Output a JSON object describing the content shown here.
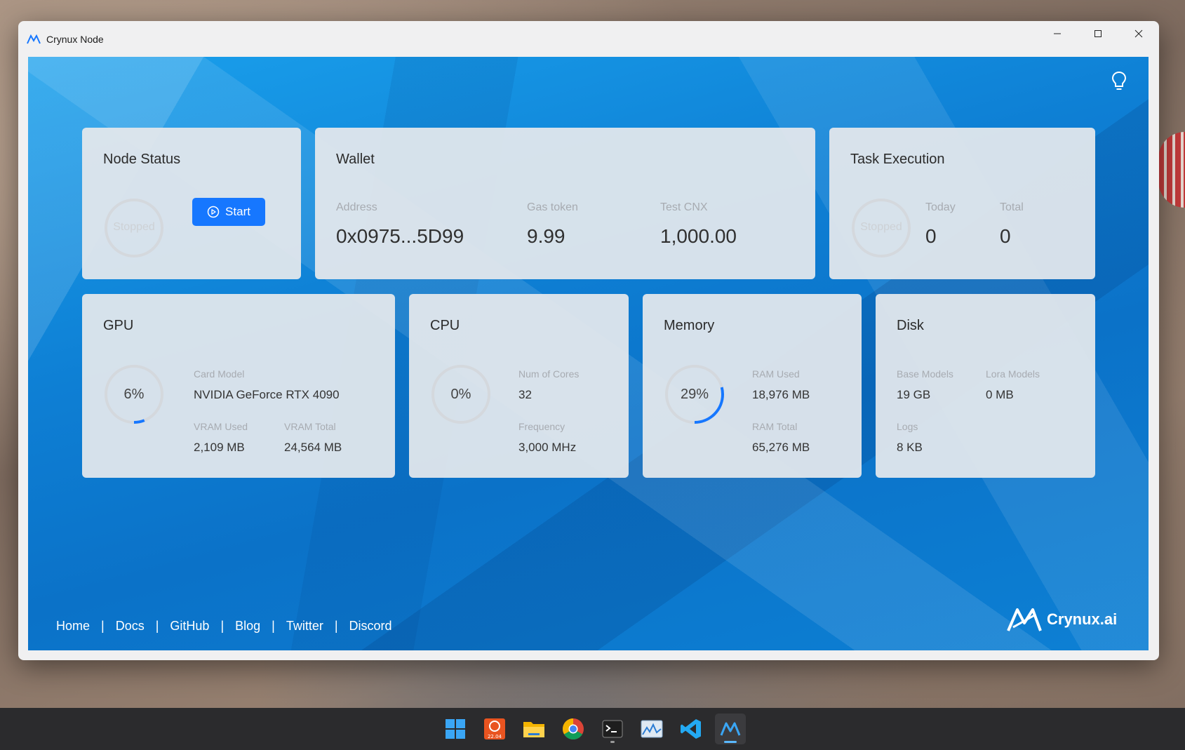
{
  "window": {
    "title": "Crynux Node"
  },
  "node_status": {
    "title": "Node Status",
    "state": "Stopped",
    "start_label": "Start"
  },
  "wallet": {
    "title": "Wallet",
    "address_label": "Address",
    "address": "0x0975...5D99",
    "gas_label": "Gas token",
    "gas_value": "9.99",
    "cnx_label": "Test CNX",
    "cnx_value": "1,000.00"
  },
  "task_execution": {
    "title": "Task Execution",
    "state": "Stopped",
    "today_label": "Today",
    "today_value": "0",
    "total_label": "Total",
    "total_value": "0"
  },
  "gpu": {
    "title": "GPU",
    "usage_text": "6%",
    "usage": 0.06,
    "card_model_label": "Card Model",
    "card_model": "NVIDIA GeForce RTX 4090",
    "vram_used_label": "VRAM Used",
    "vram_used": "2,109 MB",
    "vram_total_label": "VRAM Total",
    "vram_total": "24,564 MB"
  },
  "cpu": {
    "title": "CPU",
    "usage_text": "0%",
    "usage": 0,
    "cores_label": "Num of Cores",
    "cores": "32",
    "freq_label": "Frequency",
    "freq": "3,000 MHz"
  },
  "memory": {
    "title": "Memory",
    "usage_text": "29%",
    "usage": 0.29,
    "ram_used_label": "RAM Used",
    "ram_used": "18,976 MB",
    "ram_total_label": "RAM Total",
    "ram_total": "65,276 MB"
  },
  "disk": {
    "title": "Disk",
    "base_label": "Base Models",
    "base": "19 GB",
    "lora_label": "Lora Models",
    "lora": "0 MB",
    "logs_label": "Logs",
    "logs": "8 KB"
  },
  "footer": {
    "links": [
      "Home",
      "Docs",
      "GitHub",
      "Blog",
      "Twitter",
      "Discord"
    ],
    "separator": "|",
    "brand": "Crynux.ai"
  },
  "taskbar": {
    "apps": [
      "start-icon",
      "ubuntu-icon",
      "file-explorer-icon",
      "chrome-icon",
      "terminal-icon",
      "resource-monitor-icon",
      "vscode-icon",
      "crynux-icon"
    ],
    "ubuntu_label": "22.04"
  },
  "colors": {
    "accent": "#1677ff",
    "ring_progress": "#1677ff",
    "ring_track": "#d4d8dd"
  }
}
